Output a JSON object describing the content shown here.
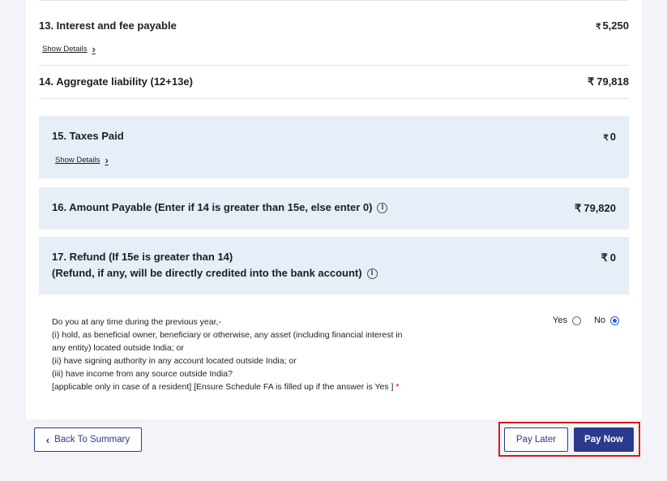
{
  "items": {
    "interest": {
      "label": "13. Interest and fee payable",
      "currency": "₹",
      "amount": "5,250",
      "show_details": "Show Details"
    },
    "aggregate": {
      "label": "14. Aggregate liability (12+13e)",
      "currency": "₹",
      "amount": "79,818"
    },
    "taxes_paid": {
      "label": "15. Taxes Paid",
      "currency": "₹",
      "amount": "0",
      "show_details": "Show Details"
    },
    "amount_payable": {
      "label": "16. Amount Payable (Enter if 14 is greater than 15e, else enter 0)",
      "currency": "₹",
      "amount": "79,820"
    },
    "refund": {
      "label_line1": "17. Refund (If 15e is greater than 14)",
      "label_line2": "(Refund, if any, will be directly credited into the bank account)",
      "currency": "₹",
      "amount": "0"
    }
  },
  "foreign_asset_question": {
    "lines": [
      "Do you at any time during the previous year,-",
      "(i) hold, as beneficial owner, beneficiary or otherwise, any asset (including financial interest in",
      "any entity) located outside India; or",
      "(ii) have signing authority in any account located outside India; or",
      "(iii) have income from any source outside India?",
      "[applicable only in case of a resident] [Ensure Schedule FA is filled up if the answer is Yes ]"
    ],
    "required_mark": "*",
    "options": {
      "yes": "Yes",
      "no": "No"
    },
    "selected": "No"
  },
  "footer": {
    "back_label": "Back To Summary",
    "pay_later_label": "Pay Later",
    "pay_now_label": "Pay Now"
  },
  "colors": {
    "accent": "#2b3a8c",
    "highlight_box": "#e01818",
    "info_box_bg": "#e6eef8"
  }
}
